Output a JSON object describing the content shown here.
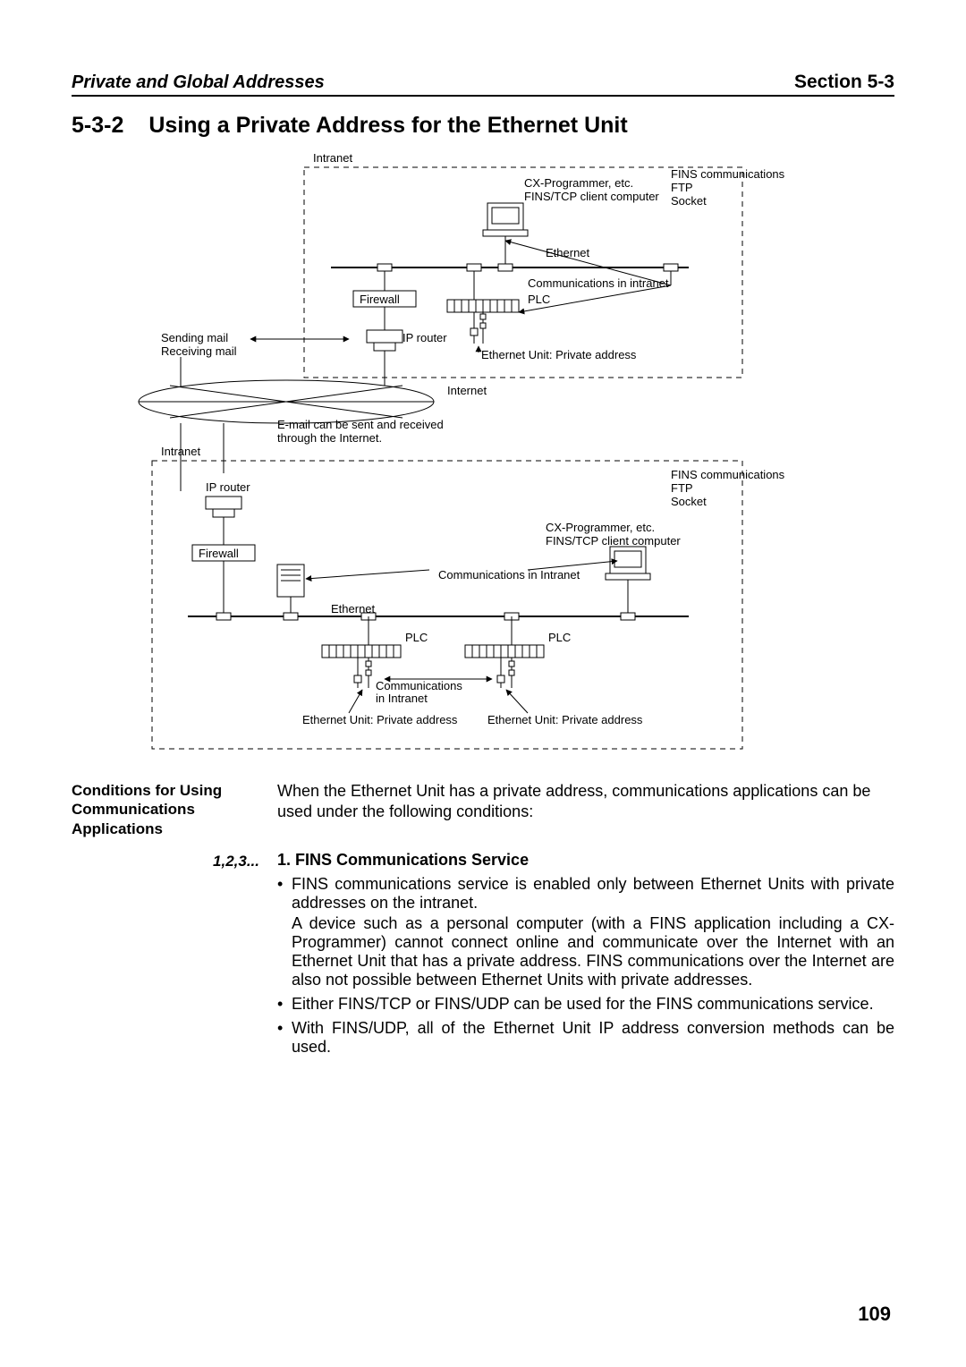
{
  "header": {
    "left": "Private and Global Addresses",
    "right": "Section 5-3"
  },
  "title": {
    "number": "5-3-2",
    "text": "Using a Private Address for the Ethernet Unit"
  },
  "diagram": {
    "intranet_top": "Intranet",
    "cx1_line1": "CX-Programmer, etc.",
    "cx1_line2": "FINS/TCP client computer",
    "fins_box1_l1": "FINS communications",
    "fins_box1_l2": "FTP",
    "fins_box1_l3": "Socket",
    "ethernet_top": "Ethernet",
    "comm_in_intranet1": "Communications in intranet",
    "firewall_top": "Firewall",
    "plc_top": "PLC",
    "ip_router_top": "IP router",
    "eth_unit_top": "Ethernet Unit: Private address",
    "sending_mail": "Sending mail",
    "receiving_mail": "Receiving mail",
    "internet": "Internet",
    "email_note_l1": "E-mail can be sent and received",
    "email_note_l2": "through the Internet.",
    "intranet_bot": "Intranet",
    "ip_router_bot": "IP router",
    "firewall_bot": "Firewall",
    "fins_box2_l1": "FINS communications",
    "fins_box2_l2": "FTP",
    "fins_box2_l3": "Socket",
    "cx2_line1": "CX-Programmer, etc.",
    "cx2_line2": "FINS/TCP client computer",
    "comm_in_intranet2": "Communications in Intranet",
    "ethernet_bot": "Ethernet",
    "plc_bot": "PLC",
    "plc_bot2": "PLC",
    "comm_in_intranet3_l1": "Communications",
    "comm_in_intranet3_l2": "in Intranet",
    "eth_unit_bot1": "Ethernet Unit: Private address",
    "eth_unit_bot2": "Ethernet Unit: Private address"
  },
  "side_heading": "Conditions for Using Communications Applications",
  "intro_para": "When the Ethernet Unit has a private address, communications applications can be used under the following conditions:",
  "list_side": "1,2,3...",
  "item1": {
    "title": "1. FINS Communications Service",
    "b1": "FINS communications service is enabled only between Ethernet Units with private addresses on the intranet.",
    "b1_sub": "A device such as a personal computer (with a FINS application including a CX-Programmer) cannot connect online and communicate over the Internet with an Ethernet Unit that has a private address. FINS communications over the Internet are also not possible between Ethernet Units with private addresses.",
    "b2": "Either FINS/TCP or FINS/UDP can be used for the FINS communications service.",
    "b3": "With FINS/UDP, all of the Ethernet Unit IP address conversion methods can be used."
  },
  "page_number": "109"
}
